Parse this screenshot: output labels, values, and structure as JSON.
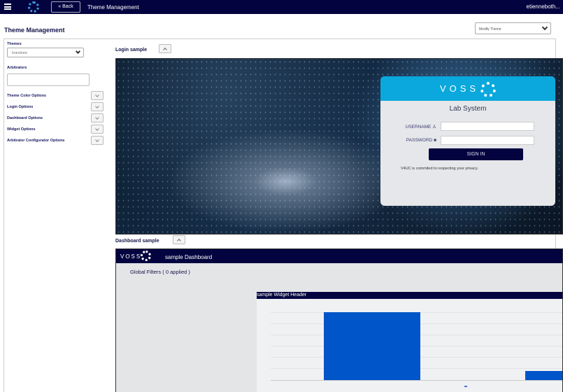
{
  "topbar": {
    "back_label": "« Back",
    "title": "Theme Management",
    "user": "etienneboth..."
  },
  "page": {
    "title": "Theme Management",
    "action_select": "Modify Theme"
  },
  "sidebar": {
    "themes_label": "Themes",
    "themes_value": "brandnew",
    "arbitrators_label": "Arbitrators",
    "arbitrators_value": "",
    "options": [
      {
        "label": "Theme Color Options"
      },
      {
        "label": "Login Options"
      },
      {
        "label": "Dashboard Options"
      },
      {
        "label": "Widget Options"
      },
      {
        "label": "Arbitrator Configurator Options"
      }
    ]
  },
  "login_sample": {
    "label": "Login sample",
    "brand": "VOSS",
    "system": "Lab System",
    "username_label": "USERNAME",
    "password_label": "PASSWORD",
    "sign_in": "SIGN IN",
    "privacy": "V4UC is commited to respecting your privacy.",
    "header_color": "#0aa8dc",
    "button_color": "#03033f"
  },
  "dashboard_sample": {
    "label": "Dashboard sample",
    "brand": "VOSS",
    "title": "sample Dashboard",
    "filters": "Global Filters ( 0 applied )",
    "widget_header": "sample Widget Header",
    "bar_color": "#0055c8"
  }
}
